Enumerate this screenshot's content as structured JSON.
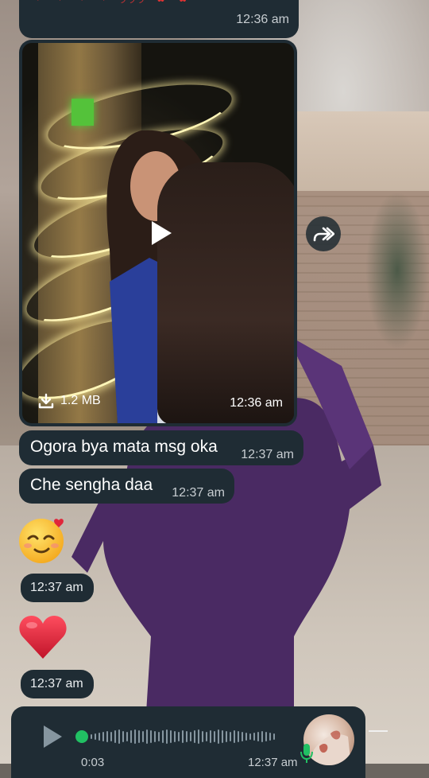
{
  "top_message": {
    "emojis": "❤ ❤ ❤ ❤ ◞◞◞ ✿ ✿",
    "time": "12:36 am"
  },
  "video_message": {
    "file_size": "1.2 MB",
    "time": "12:36 am"
  },
  "messages": [
    {
      "text": "Ogora bya mata msg oka",
      "time": "12:37 am"
    },
    {
      "text": "Che sengha daa",
      "time": "12:37 am"
    }
  ],
  "emoji_messages": [
    {
      "emoji": "smiling-face-with-hearts",
      "time": "12:37 am"
    },
    {
      "emoji": "red-heart",
      "time": "12:37 am"
    }
  ],
  "voice_message": {
    "duration": "0:03",
    "time": "12:37 am",
    "progress": 0
  },
  "colors": {
    "bubble": "#1f2c34",
    "accent_green": "#21c063",
    "heart_red": "#e0263a"
  }
}
